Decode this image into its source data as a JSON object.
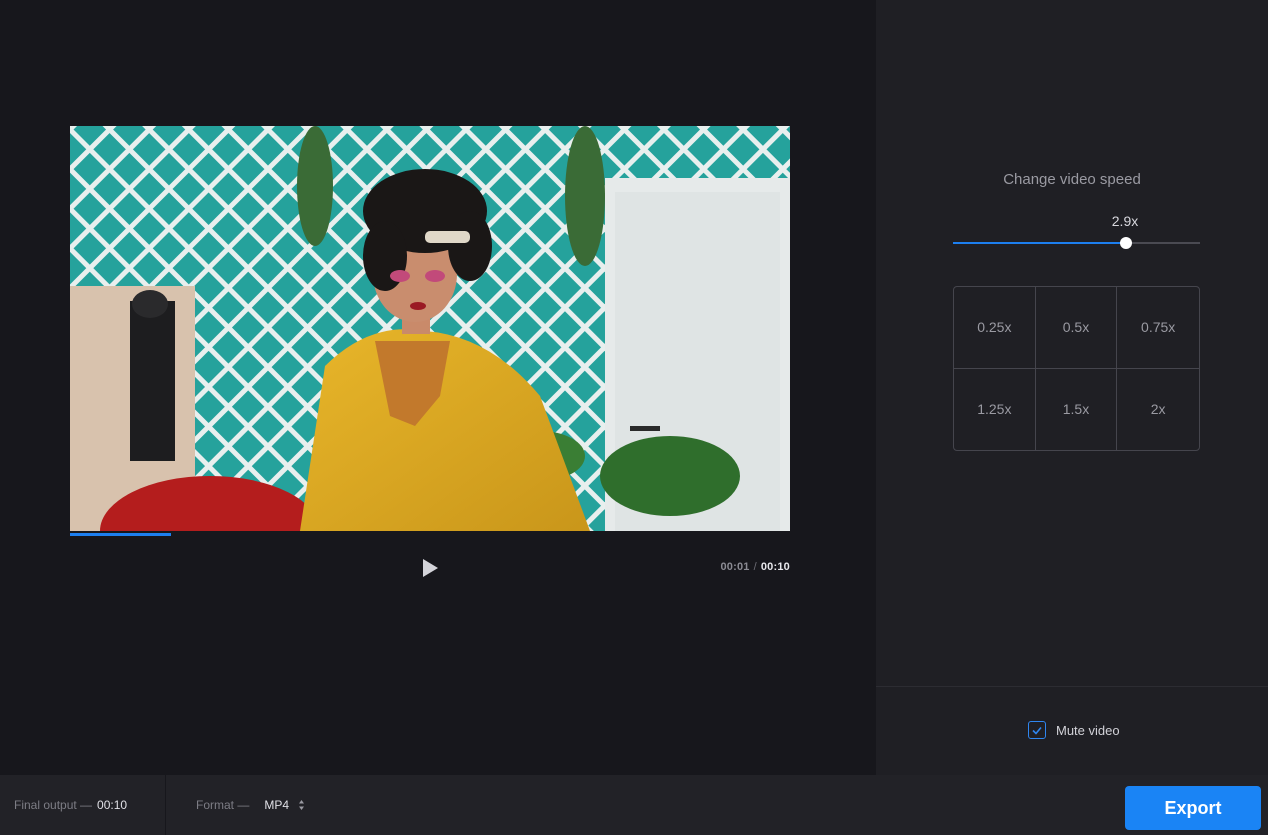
{
  "player": {
    "current_time": "00:01",
    "separator": "/",
    "total_time": "00:10",
    "progress": 0.14
  },
  "speed_panel": {
    "title": "Change video speed",
    "current_speed_label": "2.9x",
    "speed_fraction": 0.7,
    "presets": [
      "0.25x",
      "0.5x",
      "0.75x",
      "1.25x",
      "1.5x",
      "2x"
    ]
  },
  "mute": {
    "label": "Mute video",
    "checked": true
  },
  "bottom_bar": {
    "final_output_label": "Final output —",
    "final_output_value": "00:10",
    "format_label": "Format —",
    "format_value": "MP4",
    "export_label": "Export"
  },
  "colors": {
    "accent": "#1a84f5",
    "background": "#17171c",
    "panel": "#1f1f24"
  },
  "icons": {
    "play": "play-icon",
    "checkbox": "check-icon",
    "format_select": "sort-arrows-icon"
  }
}
